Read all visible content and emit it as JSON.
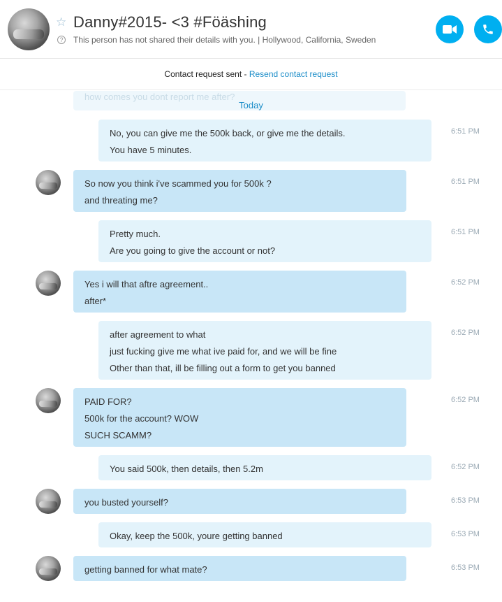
{
  "header": {
    "name": "Danny#2015-  <3 #Föäshing",
    "subtitle": "This person has not shared their details with you. | Hollywood, California, Sweden",
    "star_icon": "star-icon",
    "help_icon": "question-circle-icon",
    "video_call_icon": "video-camera-icon",
    "audio_call_icon": "phone-icon"
  },
  "notice": {
    "text": "Contact request sent - ",
    "link": "Resend contact request"
  },
  "faded_message": "how comes you dont report me after?",
  "day_separator": "Today",
  "messages": [
    {
      "dir": "out",
      "lines": [
        "No, you can give me the 500k back, or give me the details.",
        "You have 5 minutes."
      ],
      "time": "6:51 PM"
    },
    {
      "dir": "in",
      "lines": [
        "So now you think i've scammed you for 500k ?",
        "and threating me?"
      ],
      "time": "6:51 PM"
    },
    {
      "dir": "out",
      "lines": [
        "Pretty much.",
        "Are you going to give the account or not?"
      ],
      "time": "6:51 PM"
    },
    {
      "dir": "in",
      "lines": [
        "Yes i will that aftre agreement..",
        "after*"
      ],
      "time": "6:52 PM"
    },
    {
      "dir": "out",
      "lines": [
        "after agreement to what",
        "just fucking give me what ive paid for, and we will be fine",
        "Other than that, ill be filling out a form to get you banned"
      ],
      "time": "6:52 PM"
    },
    {
      "dir": "in",
      "lines": [
        "PAID FOR?",
        "500k for the account? WOW",
        "SUCH SCAMM?"
      ],
      "time": "6:52 PM"
    },
    {
      "dir": "out",
      "lines": [
        "You said 500k, then details, then 5.2m"
      ],
      "time": "6:52 PM"
    },
    {
      "dir": "in",
      "lines": [
        "you busted yourself?"
      ],
      "time": "6:53 PM"
    },
    {
      "dir": "out",
      "lines": [
        "Okay, keep the 500k, youre getting banned"
      ],
      "time": "6:53 PM"
    },
    {
      "dir": "in",
      "lines": [
        "getting banned for what mate?"
      ],
      "time": "6:53 PM"
    }
  ],
  "colors": {
    "accent": "#00aff0",
    "link": "#1a8cc8",
    "incoming_bubble": "#c8e6f7",
    "outgoing_bubble": "#e3f3fb",
    "timestamp": "#9aa9b4"
  }
}
